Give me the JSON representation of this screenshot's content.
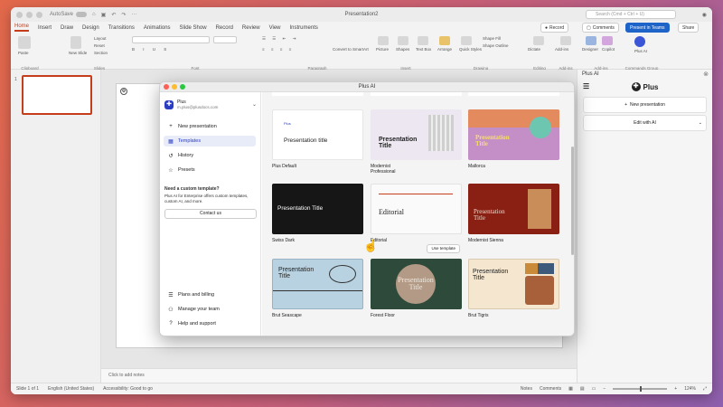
{
  "app": {
    "autosave_label": "AutoSave",
    "doc_title": "Presentation2",
    "search_placeholder": "Search (Cmd + Ctrl + U)",
    "tabs": [
      "Home",
      "Insert",
      "Draw",
      "Design",
      "Transitions",
      "Animations",
      "Slide Show",
      "Record",
      "Review",
      "View",
      "Instruments"
    ],
    "active_tab": "Home"
  },
  "ribbon": {
    "groups": [
      "Clipboard",
      "Slides",
      "Font",
      "Paragraph",
      "Insert",
      "Drawing",
      "Editing",
      "Add-ins",
      "Add-ins",
      "Commands Group"
    ],
    "paste": "Paste",
    "new_slide": "New Slide",
    "layout": "Layout",
    "reset": "Reset",
    "section": "Section",
    "convert_smartart": "Convert to SmartArt",
    "picture": "Picture",
    "shapes": "Shapes",
    "text_box": "Text Box",
    "arrange": "Arrange",
    "quick_styles": "Quick Styles",
    "shape_fill": "Shape Fill",
    "shape_outline": "Shape Outline",
    "dictate": "Dictate",
    "addins": "Add-ins",
    "designer": "Designer",
    "copilot": "Copilot",
    "plus": "Plus AI",
    "record_btn": "Record",
    "comments_btn": "Comments",
    "present_btn": "Present in Teams",
    "share_btn": "Share"
  },
  "slides_pane": {
    "slide_number": "1"
  },
  "editor": {
    "notes_placeholder": "Click to add notes"
  },
  "status": {
    "slide_info": "Slide 1 of 1",
    "language": "English (United States)",
    "accessibility": "Accessibility: Good to go",
    "notes": "Notes",
    "comments": "Comments",
    "zoom": "124%"
  },
  "taskpane": {
    "title": "Plus AI",
    "brand": "Plus",
    "new_presentation": "New presentation",
    "edit_with_ai": "Edit with AI"
  },
  "dialog": {
    "title": "Plus AI",
    "account": {
      "name": "Plus",
      "email": "m.plus@plusdocs.com"
    },
    "nav": [
      {
        "icon": "+",
        "label": "New presentation"
      },
      {
        "icon": "▦",
        "label": "Templates"
      },
      {
        "icon": "↺",
        "label": "History"
      },
      {
        "icon": "☆",
        "label": "Presets"
      }
    ],
    "active_nav": "Templates",
    "custom_title": "Need a custom template?",
    "custom_text": "Plus AI for Enterprise offers custom templates, custom AI, and more.",
    "contact_us": "Contact us",
    "footer_nav": [
      {
        "icon": "☰",
        "label": "Plans and billing"
      },
      {
        "icon": "⚇",
        "label": "Manage your team"
      },
      {
        "icon": "?",
        "label": "Help and support"
      }
    ],
    "use_template": "Use template",
    "templates": [
      {
        "name": "Plus Default",
        "title": "Presentation title",
        "badge": "Plus"
      },
      {
        "name": "Modernist\nProfessional",
        "title": "Presentation\nTitle"
      },
      {
        "name": "Mallorca",
        "title": "Presentation\nTitle"
      },
      {
        "name": "Swiss Dark",
        "title": "Presentation Title"
      },
      {
        "name": "Editorial",
        "title": "Editorial"
      },
      {
        "name": "Modernist Sienna",
        "title": "Presentation\nTitle"
      },
      {
        "name": "Brut Seascape",
        "title": "Presentation\nTitle"
      },
      {
        "name": "Forest Floor",
        "title": "Presentation\nTitle"
      },
      {
        "name": "Brut Tigris",
        "title": "Presentation\nTitle"
      }
    ]
  }
}
